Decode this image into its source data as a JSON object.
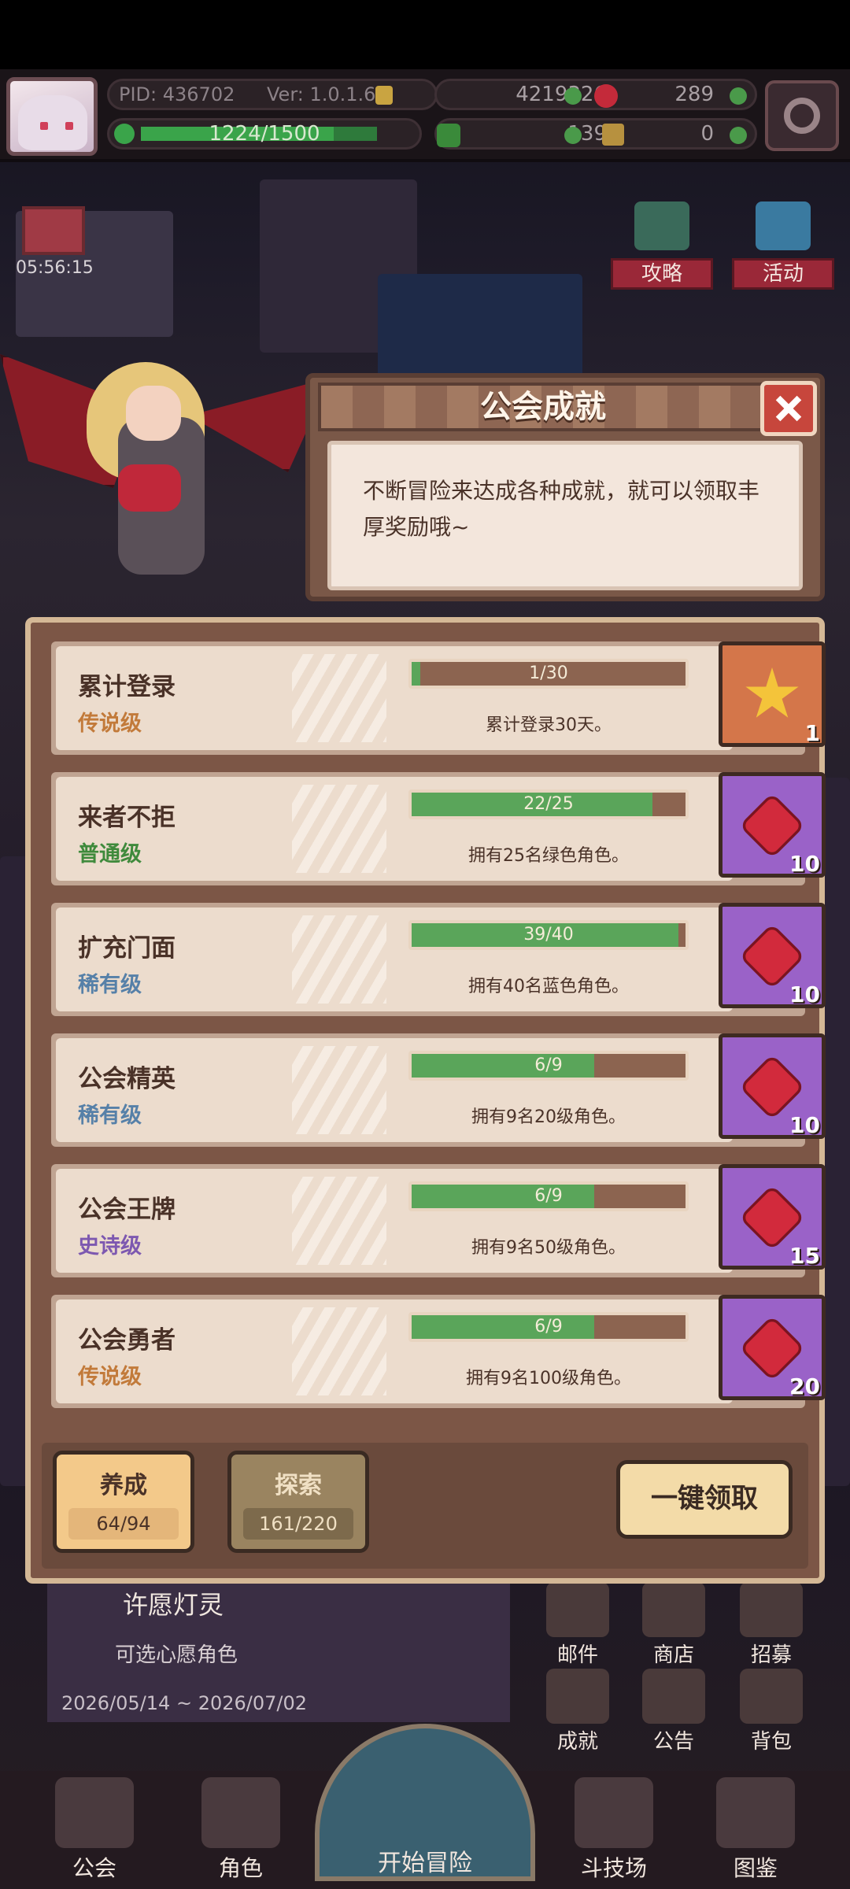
{
  "topbar": {
    "pid": "PID: 436702",
    "version": "Ver: 1.0.1.6",
    "xp": "1224/1500",
    "xp_progress": 0.816,
    "gold": "4219326",
    "gems": "289",
    "clover": "139",
    "hammer": "0"
  },
  "scene": {
    "gift_timer": "05:56:15",
    "guide_label": "攻略",
    "event_label": "活动"
  },
  "dialog": {
    "title": "公会成就",
    "description": "不断冒险来达成各种成就，就可以领取丰厚奖励哦~"
  },
  "achievements": [
    {
      "name": "累计登录",
      "rarity": "传说级",
      "rarity_color": "#c27a3a",
      "progress_text": "1/30",
      "progress": 0.033,
      "desc": "累计登录30天。",
      "reward": "star",
      "reward_count": "1"
    },
    {
      "name": "来者不拒",
      "rarity": "普通级",
      "rarity_color": "#3f8a3c",
      "progress_text": "22/25",
      "progress": 0.88,
      "desc": "拥有25名绿色角色。",
      "reward": "gem",
      "reward_count": "10"
    },
    {
      "name": "扩充门面",
      "rarity": "稀有级",
      "rarity_color": "#5680a8",
      "progress_text": "39/40",
      "progress": 0.975,
      "desc": "拥有40名蓝色角色。",
      "reward": "gem",
      "reward_count": "10"
    },
    {
      "name": "公会精英",
      "rarity": "稀有级",
      "rarity_color": "#5680a8",
      "progress_text": "6/9",
      "progress": 0.667,
      "desc": "拥有9名20级角色。",
      "reward": "gem",
      "reward_count": "10"
    },
    {
      "name": "公会王牌",
      "rarity": "史诗级",
      "rarity_color": "#7d58b0",
      "progress_text": "6/9",
      "progress": 0.667,
      "desc": "拥有9名50级角色。",
      "reward": "gem",
      "reward_count": "15"
    },
    {
      "name": "公会勇者",
      "rarity": "传说级",
      "rarity_color": "#c27a3a",
      "progress_text": "6/9",
      "progress": 0.667,
      "desc": "拥有9名100级角色。",
      "reward": "gem",
      "reward_count": "20"
    }
  ],
  "footer": {
    "tab_cultivate": "养成",
    "tab_cultivate_count": "64/94",
    "tab_explore": "探索",
    "tab_explore_count": "161/220",
    "claim_all": "一键领取"
  },
  "event": {
    "title": "许愿灯灵",
    "subtitle": "可选心愿角色",
    "dates": "2026/05/14 ~ 2026/07/02"
  },
  "side_menu": [
    "邮件",
    "商店",
    "招募",
    "成就",
    "公告",
    "背包"
  ],
  "nav": {
    "guild": "公会",
    "roles": "角色",
    "adventure": "开始冒险",
    "arena": "斗技场",
    "codex": "图鉴"
  }
}
